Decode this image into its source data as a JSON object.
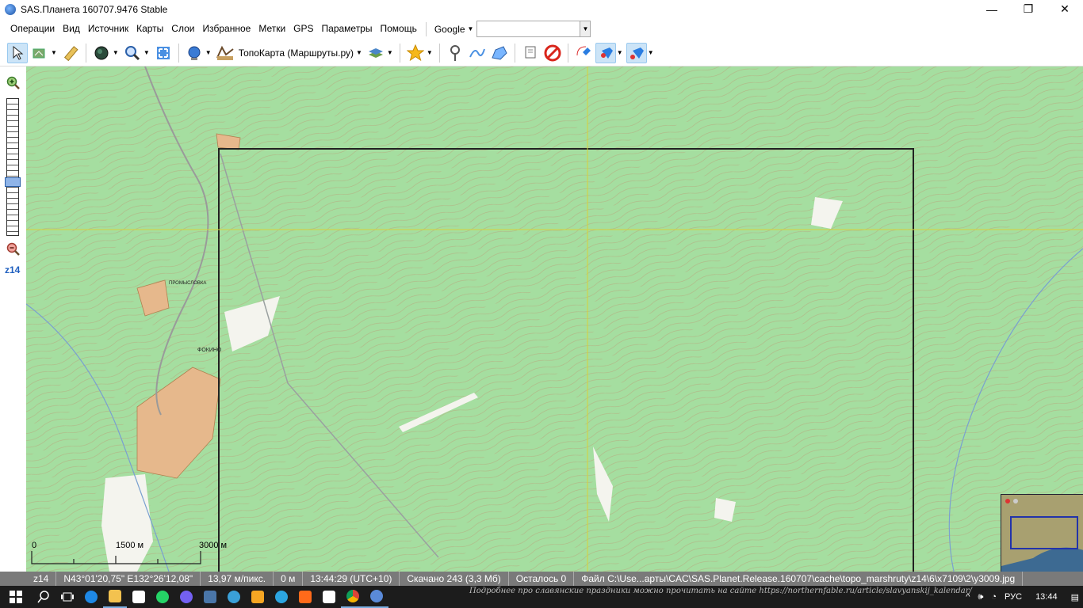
{
  "window": {
    "title": "SAS.Планета 160707.9476 Stable",
    "minimize": "—",
    "maximize": "❐",
    "close": "✕"
  },
  "menu": {
    "items": [
      "Операции",
      "Вид",
      "Источник",
      "Карты",
      "Слои",
      "Избранное",
      "Метки",
      "GPS",
      "Параметры",
      "Помощь"
    ],
    "search_provider": "Google",
    "search_value": ""
  },
  "toolbar": {
    "map_type": "ТопоКарта (Маршруты.ру)"
  },
  "zoom": {
    "level_label": "z14",
    "level_fraction": 0.62
  },
  "map": {
    "towns": [
      "ФОКИНО",
      "ПРОМЫСЛОВКА"
    ],
    "scale": {
      "labels": [
        "0",
        "1500 м",
        "3000 м"
      ]
    }
  },
  "status": {
    "zoom": "z14",
    "coords": "N43°01'20,75\" E132°26'12,08\"",
    "resolution": "13,97 м/пикс.",
    "distance": "0 м",
    "time": "13:44:29 (UTC+10)",
    "downloaded": "Скачано 243 (3,3 Мб)",
    "remaining": "Осталось 0",
    "file": "Файл C:\\Use...арты\\CAC\\SAS.Planet.Release.160707\\cache\\topo_marshruty\\z14\\6\\x7109\\2\\y3009.jpg"
  },
  "taskbar": {
    "ticker": "Подробнее про славянские праздники можно прочитать на сайте https://northernfable.ru/article/slavyanskij_kalendar/",
    "lang": "РУС",
    "clock": "13:44"
  },
  "colors": {
    "map_green": "#a5dea0",
    "frame": "#222222",
    "crosshair": "#d8d23a",
    "status_bg": "#7a7a7a"
  }
}
